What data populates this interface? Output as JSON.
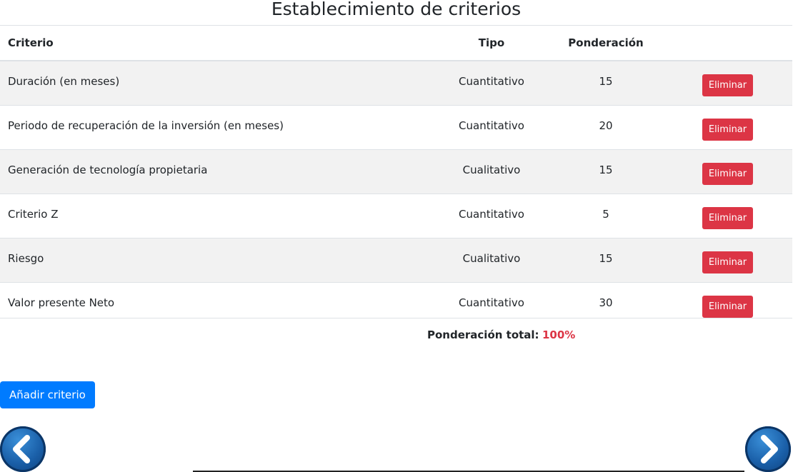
{
  "page": {
    "title": "Establecimiento de criterios"
  },
  "table": {
    "headers": {
      "criterio": "Criterio",
      "tipo": "Tipo",
      "ponderacion": "Ponderación"
    },
    "rows": [
      {
        "criterio": "Duración (en meses)",
        "tipo": "Cuantitativo",
        "ponderacion": "15",
        "action": "Eliminar"
      },
      {
        "criterio": "Periodo de recuperación de la inversión (en meses)",
        "tipo": "Cuantitativo",
        "ponderacion": "20",
        "action": "Eliminar"
      },
      {
        "criterio": "Generación de tecnología propietaria",
        "tipo": "Cualitativo",
        "ponderacion": "15",
        "action": "Eliminar"
      },
      {
        "criterio": "Criterio Z",
        "tipo": "Cuantitativo",
        "ponderacion": "5",
        "action": "Eliminar"
      },
      {
        "criterio": "Riesgo",
        "tipo": "Cualitativo",
        "ponderacion": "15",
        "action": "Eliminar"
      },
      {
        "criterio": "Valor presente Neto",
        "tipo": "Cuantitativo",
        "ponderacion": "30",
        "action": "Eliminar"
      }
    ]
  },
  "total": {
    "label": "Ponderación total:",
    "value": "100%"
  },
  "buttons": {
    "add": "Añadir criterio"
  },
  "nav": {
    "prev_icon": "chevron-left-icon",
    "next_icon": "chevron-right-icon"
  },
  "colors": {
    "danger": "#dc3545",
    "primary": "#007bff",
    "stripe": "#f2f2f2",
    "nav": "#1a5fa8"
  }
}
